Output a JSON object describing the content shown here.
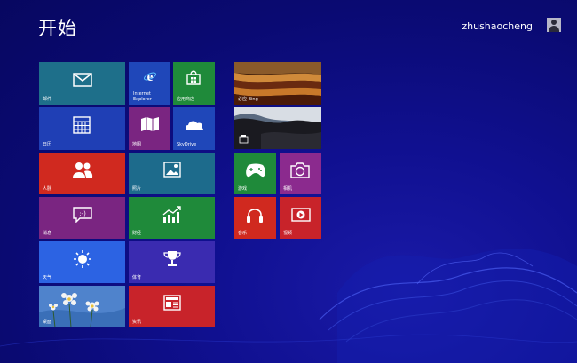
{
  "start": {
    "title": "开始"
  },
  "user": {
    "name": "zhushaocheng"
  },
  "tiles": {
    "mail": {
      "label": "邮件",
      "color": "#1e6f8a",
      "icon": "mail-icon"
    },
    "ie": {
      "label": "Internet\nExplorer",
      "color": "#1f47b9",
      "icon": "internet-explorer-icon"
    },
    "store": {
      "label": "应用商店",
      "color": "#1f8a3a",
      "icon": "store-icon"
    },
    "calendar": {
      "label": "日历",
      "color": "#1f3fb5",
      "icon": "calendar-icon"
    },
    "maps": {
      "label": "地图",
      "color": "#7a2581",
      "icon": "map-icon"
    },
    "skydrive": {
      "label": "SkyDrive",
      "color": "#1f47b9",
      "icon": "cloud-icon"
    },
    "people": {
      "label": "人脉",
      "color": "#d0291f",
      "icon": "people-icon"
    },
    "photos": {
      "label": "照片",
      "color": "#1d6b8c",
      "icon": "photo-icon"
    },
    "messaging": {
      "label": "消息",
      "color": "#7a2581",
      "icon": "chat-icon"
    },
    "finance": {
      "label": "财经",
      "color": "#1f8a3a",
      "icon": "chart-up-icon"
    },
    "weather": {
      "label": "天气",
      "color": "#2c63e3",
      "icon": "sun-icon"
    },
    "sports": {
      "label": "体育",
      "color": "#3a2bb0",
      "icon": "trophy-icon"
    },
    "desktop": {
      "label": "桌面",
      "color": "#4a7fc8",
      "icon": "desktop-wallpaper"
    },
    "news": {
      "label": "资讯",
      "color": "#c8232a",
      "icon": "news-icon"
    },
    "bing": {
      "label": "必应 Bing",
      "color": "#7a4a1a",
      "icon": "bing-photo"
    },
    "travel": {
      "label": "",
      "color": "#3a4150",
      "icon": "travel-photo"
    },
    "games": {
      "label": "游戏",
      "color": "#1f8a3a",
      "icon": "gamepad-icon"
    },
    "camera": {
      "label": "相机",
      "color": "#8b2a8e",
      "icon": "camera-icon"
    },
    "music": {
      "label": "音乐",
      "color": "#d0291f",
      "icon": "headphones-icon"
    },
    "video": {
      "label": "视频",
      "color": "#c8232a",
      "icon": "play-icon"
    }
  }
}
